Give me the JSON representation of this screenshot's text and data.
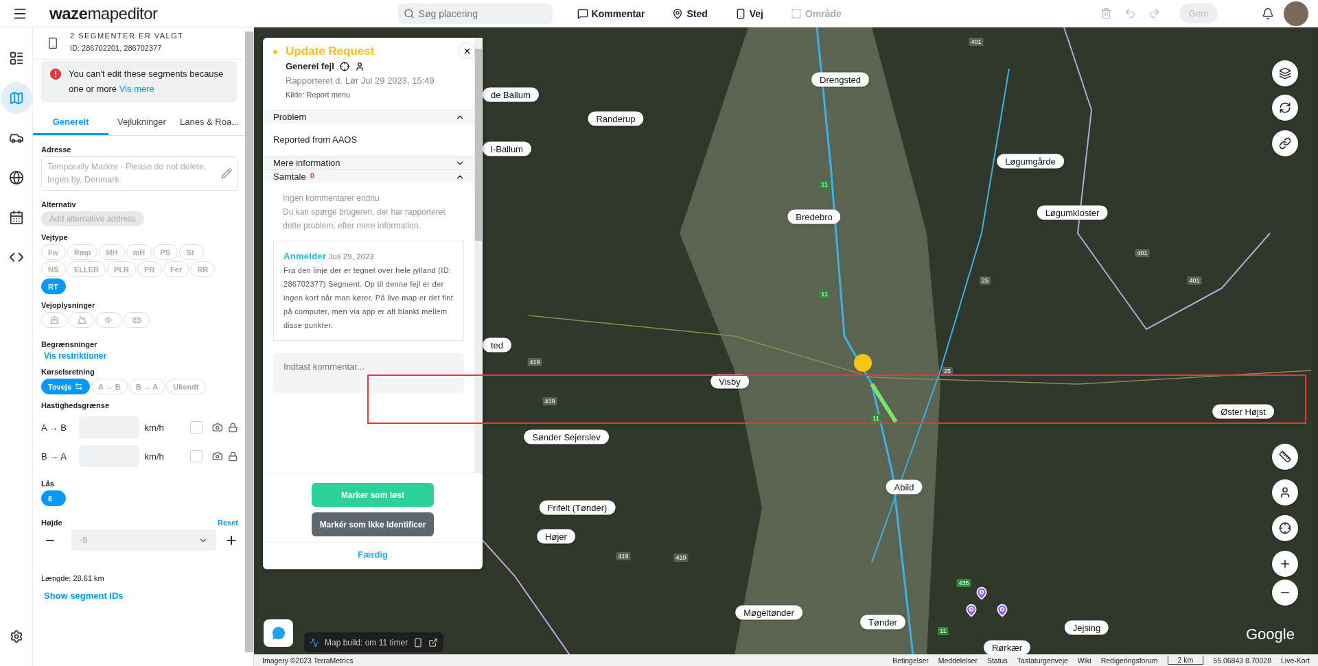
{
  "topbar": {
    "logo_bold": "waze",
    "logo_light": "mapeditor",
    "search": {
      "placeholder": "Søg placering"
    },
    "tools": [
      {
        "label": "Kommentar",
        "disabled": false
      },
      {
        "label": "Sted",
        "disabled": false
      },
      {
        "label": "Vej",
        "disabled": false
      },
      {
        "label": "Område",
        "disabled": true
      }
    ],
    "save": {
      "label": "Gem",
      "disabled": true
    }
  },
  "rail": {
    "items": [
      {
        "selected": false
      },
      {
        "selected": true
      },
      {
        "selected": false
      },
      {
        "selected": false
      },
      {
        "selected": false
      },
      {
        "selected": false
      }
    ]
  },
  "selection": {
    "title": "2 SEGMENTER ER VALGT",
    "ids": "ID: 286702201, 286702377"
  },
  "alert": {
    "text": "You can't edit these segments because one or more",
    "link": "Vis mere"
  },
  "tabs": [
    {
      "label": "Generelt",
      "selected": true
    },
    {
      "label": "Vejlukninger",
      "selected": false
    },
    {
      "label": "Lanes & Roa...",
      "selected": false
    }
  ],
  "address": {
    "label": "Adresse",
    "value": "Temporally Marker - Please do not delete, Ingen by, Denmark"
  },
  "alternative": {
    "label": "Alternativ",
    "button": "Add alternative address"
  },
  "road_type": {
    "label": "Vejtype",
    "options": [
      {
        "label": "Fw",
        "selected": false
      },
      {
        "label": "Rmp",
        "selected": false
      },
      {
        "label": "MH",
        "selected": false
      },
      {
        "label": "mH",
        "selected": false
      },
      {
        "label": "PS",
        "selected": false
      },
      {
        "label": "St",
        "selected": false
      },
      {
        "label": "NS",
        "selected": false
      },
      {
        "label": "ELLER",
        "selected": false
      },
      {
        "label": "PLR",
        "selected": false
      },
      {
        "label": "PR",
        "selected": false
      },
      {
        "label": "Fer",
        "selected": false
      },
      {
        "label": "RR",
        "selected": false
      },
      {
        "label": "RT",
        "selected": true
      }
    ]
  },
  "road_info": {
    "label": "Vejoplysninger"
  },
  "restrictions": {
    "label": "Begrænsninger",
    "link": "Vis restriktioner"
  },
  "direction": {
    "label": "Kørselsretning",
    "options": [
      {
        "label": "Tovejs",
        "selected": true
      },
      {
        "label": "A → B",
        "selected": false
      },
      {
        "label": "B → A",
        "selected": false
      },
      {
        "label": "Ukendt",
        "selected": false
      }
    ]
  },
  "speed": {
    "label": "Hastighedsgrænse",
    "rows": [
      {
        "direction": "A → B",
        "unit": "km/h",
        "checked": false
      },
      {
        "direction": "B → A",
        "unit": "km/h",
        "checked": false
      }
    ]
  },
  "lock": {
    "label": "Lås",
    "options": [
      {
        "label": "6",
        "selected": true
      }
    ]
  },
  "elevation": {
    "label": "Højde",
    "reset": "Reset",
    "value": "-5"
  },
  "length": "Længde: 28.61 km",
  "show_ids": "Show segment IDs",
  "update_request": {
    "title": "Update Request",
    "type": "Generel fejl",
    "reported": "Rapporteret d. Lør Jul 29 2023, 15:49",
    "source": "Kilde: Report menu",
    "sections": [
      {
        "title": "Problem",
        "expanded": true
      },
      {
        "title": "Mere information",
        "expanded": false
      },
      {
        "title": "Samtale",
        "count": "0",
        "expanded": true
      }
    ],
    "problem": "Reported from AAOS",
    "no_comments": "Ingen kommentarer endnu",
    "hint": "Du kan spørge brugeren, der har rapporteret dette problem, efter mere information.",
    "comment": {
      "author": "Anmelder",
      "date": "Juli 29, 2023",
      "text": "Fra den linje der er tegnet over hele jylland (ID: 286702377) Segment. Op til denne fejl er der ingen kort når man kører. På live map er det fint på computer, men via app er alt blankt mellem disse punkter."
    },
    "input": {
      "placeholder": "Indtast kommentar..."
    },
    "solve": "Marker som løst",
    "not_identified": "Markér som Ikke Identificer",
    "done": "Færdig"
  },
  "map": {
    "cities": [
      "Drengsted",
      "de Ballum",
      "Randerup",
      "l-Ballum",
      "Løgumgårde",
      "Bredebro",
      "Løgumkloster",
      "ted",
      "Visby",
      "Øster Højst",
      "Sønder Sejerslev",
      "Abild",
      "Frifelt (Tønder)",
      "Højer",
      "Møgeltønder",
      "Tønder",
      "Jejsing",
      "Rørkær"
    ],
    "roads": [
      {
        "label": "11",
        "kind": "main"
      },
      {
        "label": "11",
        "kind": "main"
      },
      {
        "label": "11",
        "kind": "main"
      },
      {
        "label": "11",
        "kind": "main"
      },
      {
        "label": "401",
        "kind": "minor"
      },
      {
        "label": "401",
        "kind": "minor"
      },
      {
        "label": "401",
        "kind": "minor"
      },
      {
        "label": "435",
        "kind": "main"
      },
      {
        "label": "419",
        "kind": "minor"
      },
      {
        "label": "419",
        "kind": "minor"
      },
      {
        "label": "419",
        "kind": "minor"
      },
      {
        "label": "419",
        "kind": "minor"
      },
      {
        "label": "25",
        "kind": "minor"
      },
      {
        "label": "25",
        "kind": "minor"
      }
    ],
    "build": "Map build: om 11 timer",
    "brand": "Google"
  },
  "footer": {
    "imagery": "Imagery ©2023 TerraMetrics",
    "links": [
      "Betingelser",
      "Meddelelser",
      "Status",
      "Tastaturgenveje",
      "Wiki",
      "Redigeringsforum"
    ],
    "scale": "2 km",
    "coords": "55.06843 8.70028",
    "live": "Live-Kort"
  }
}
